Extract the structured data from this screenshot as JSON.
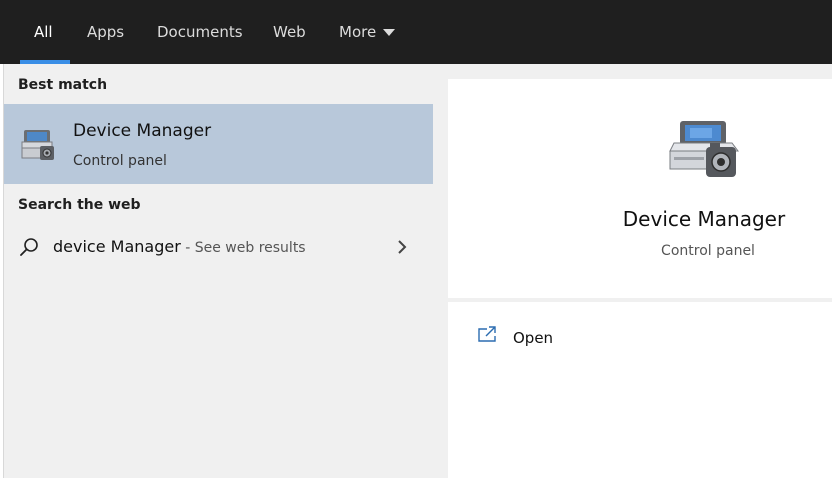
{
  "tabs": [
    {
      "label": "All",
      "active": true
    },
    {
      "label": "Apps",
      "active": false
    },
    {
      "label": "Documents",
      "active": false
    },
    {
      "label": "Web",
      "active": false
    },
    {
      "label": "More",
      "active": false
    }
  ],
  "results": {
    "best_match_header": "Best match",
    "best_match": {
      "title": "Device Manager",
      "subtitle": "Control panel",
      "icon": "device-manager-icon"
    },
    "web_header": "Search the web",
    "web_result": {
      "query": "device Manager",
      "suffix": " - See web results",
      "icon": "search-icon"
    }
  },
  "preview": {
    "title": "Device Manager",
    "subtitle": "Control panel",
    "actions": [
      {
        "label": "Open",
        "icon": "open-icon"
      }
    ]
  },
  "colors": {
    "topbar": "#1f1f1f",
    "active_tab_underline": "#3a8ee6",
    "selected_item": "#b8c8da",
    "panel_bg": "#f0f0f0",
    "preview_bg": "#ffffff"
  }
}
